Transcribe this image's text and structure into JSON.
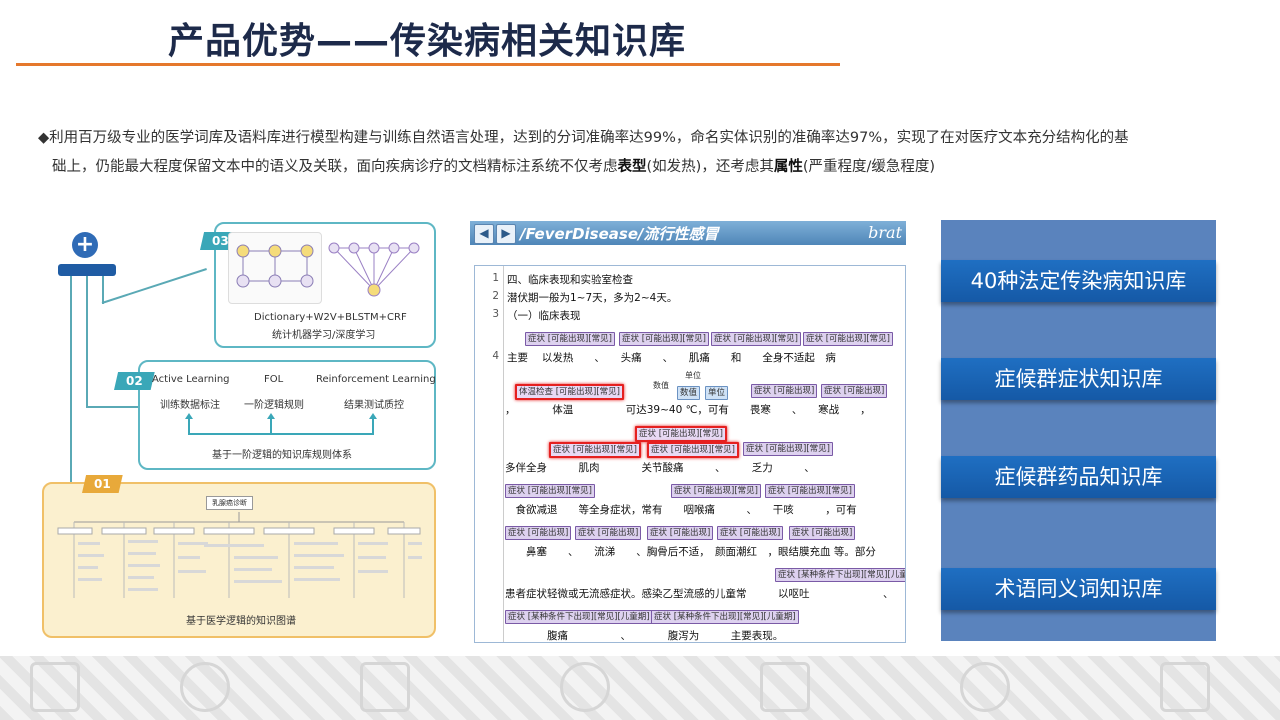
{
  "header": {
    "title": "产品优势——传染病相关知识库"
  },
  "description": {
    "line1": "◆利用百万级专业的医学词库及语料库进行模型构建与训练自然语言处理，达到的分词准确率达99%，命名实体识别的准确率达97%，实现了在对医疗文本充分结构化的基",
    "line2_prefix": "础上，仍能最大程度保留文本中的语义及关联，面向疾病诊疗的文档精标注系统不仅考虑",
    "bold1": "表型",
    "mid": "(如发热)，还考虑其",
    "bold2": "属性",
    "suffix": "(严重程度/缓急程度)"
  },
  "diagram": {
    "box03": {
      "tag": "03",
      "line1": "Dictionary+W2V+BLSTM+CRF",
      "line2": "统计机器学习/深度学习"
    },
    "box02": {
      "tag": "02",
      "col1_title": "Active Learning",
      "col1_sub": "训练数据标注",
      "col2_title": "FOL",
      "col2_sub": "一阶逻辑规则",
      "col3_title": "Reinforcement Learning",
      "col3_sub": "结果测试质控",
      "footer": "基于一阶逻辑的知识库规则体系"
    },
    "box01": {
      "tag": "01",
      "root": "乳腺癌诊断",
      "footer": "基于医学逻辑的知识图谱"
    }
  },
  "brat": {
    "path": "/FeverDisease/流行性感冒",
    "logo": "brat",
    "ln1": "1",
    "line1": "四、临床表现和实验室检查",
    "ln2": "2",
    "line2": "潜伏期一般为1~7天，多为2~4天。",
    "ln3": "3",
    "line3": "（一）临床表现",
    "ln4": "4",
    "row4": "主要　 以发热　　、　　头痛　　、　　肌痛　　和　　全身不适起　病",
    "row5": "，　　　　体温　　　　　可达39~40 ℃，可有　　畏寒　　、　　寒战　　，",
    "row6": "多伴全身　　　肌肉　　　　关节酸痛　　　、　　　乏力　　　、",
    "row7": "　食欲减退　　等全身症状，常有　　咽喉痛　　　、　　干咳　　　，可有",
    "row8": "　　鼻塞　　、　　流涕　　、胸骨后不适，　颜面潮红　，眼结膜充血 等。部分",
    "row9": "患者症状轻微或无流感症状。感染乙型流感的儿童常　　　以呕吐　　　　　　　、",
    "row10": "　　　　腹痛　　　　　、　　　　腹泻为　　　主要表现。",
    "ann_symptom": "症状 [可能出现][常见]",
    "ann_symptom_short": "症状 [可能出现]",
    "ann_body_temp": "体温检查 [可能出现][常见]",
    "ann_numeric": "数值",
    "ann_unit": "单位",
    "ann_child": "症状 [某种条件下出现][常见][儿童期]",
    "rel_unit": "单位",
    "rel_numeric": "数值"
  },
  "knowledge_bases": [
    "40种法定传染病知识库",
    "症候群症状知识库",
    "症候群药品知识库",
    "术语同义词知识库"
  ]
}
